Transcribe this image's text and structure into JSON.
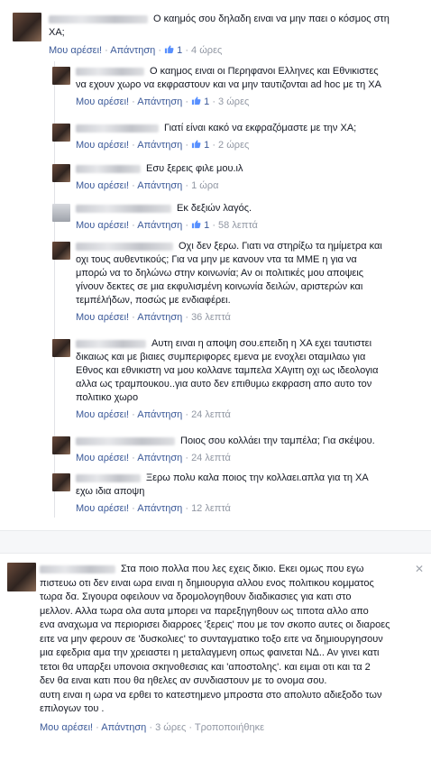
{
  "actions": {
    "like": "Μου αρέσει!",
    "reply": "Απάντηση",
    "dot": "·",
    "edited": "Τροποποιήθηκε"
  },
  "icons": {
    "like": "thumbs-up-icon",
    "close": "close-icon"
  },
  "colors": {
    "link": "#3b5998",
    "meta": "#9197a3",
    "text": "#141823"
  },
  "top_comment": {
    "text1": "Ο καημός σου δηλαδη ειναι να μην παει ο κόσμος στη",
    "text2": "ΧΑ;",
    "likes": "1",
    "time": "4 ώρες"
  },
  "replies": [
    {
      "lines": [
        "Ο καημος ειναι οι Περηφανοι Ελληνες και Εθνικιστες",
        "να εχουν χωρο να εκφραστουν και να μην ταυτιζονται ad hoc με τη ΧΑ"
      ],
      "likes": "1",
      "time": "3 ώρες"
    },
    {
      "lines": [
        "Γιατί είναι κακό να εκφραζόμαστε με την ΧΑ;"
      ],
      "likes": "1",
      "time": "2 ώρες"
    },
    {
      "lines": [
        "Εσυ ξερεις φιλε μου.ιλ"
      ],
      "likes": "",
      "time": "1 ώρα"
    },
    {
      "lines": [
        "Εκ δεξιών λαγός."
      ],
      "likes": "1",
      "time": "58 λεπτά"
    },
    {
      "lines": [
        "Οχι δεν ξερω. Γιατι να στηρίξω τα ημίμετρα και",
        "οχι τους αυθεντικούς; Για να μην με κανουν ντα τα ΜΜΕ η για να",
        "μπορώ να το δηλώνω στην κοινωνία; Αν οι πολιτικές μου αποψεις",
        "γίνουν δεκτες σε μια εκφυλισμένη κοινωνία δειλών, αριστερών και",
        "τεμπέλήδων, ποσώς με ενδιαφέρει."
      ],
      "likes": "",
      "time": "36 λεπτά"
    },
    {
      "lines": [
        "Αυτη ειναι η αποψη σου.επειδη η ΧΑ εχει ταυτιστει",
        "δικαιως και με βιαιες συμπεριφορες εμενα με ενοχλει οταμιλαω για",
        "Εθνος και εθνικιστη να μου κολλανε ταμπελα ΧΑγιτη οχι ως ιδεολογια",
        "αλλα ως τραμπουκου..για αυτο δεν επιθυμω εκφραση απο αυτο τον",
        "πολιτικο χωρο"
      ],
      "likes": "",
      "time": "24 λεπτά"
    },
    {
      "lines": [
        "Ποιος σου κολλάει την ταμπέλα; Για σκέψου."
      ],
      "likes": "",
      "time": "24 λεπτά"
    },
    {
      "lines": [
        "Ξερω πολυ καλα ποιος την κολλαει.απλα για τη ΧΑ",
        "εχω ιδια αποψη"
      ],
      "likes": "",
      "time": "12 λεπτά"
    }
  ],
  "second_comment": {
    "lines": [
      "Στα ποιο πολλα που λες εχεις δικιο. Εκει ομως που εγω",
      "πιστευω οτι δεν ειναι ωρα ειναι η δημιουργια αλλου ενος πολιτικου κομματος",
      "τωρα δα. Σιγουρα οφειλουν να δρομολογηθουν διαδικασιες για κατι στο",
      "μελλον. Αλλα τωρα ολα αυτα μπορει να παρεξηγηθουν ως τιποτα αλλο απο",
      "ενα αναχωμα να περιορισει διαρροες 'ξερεις' που με τον σκοπο αυτες οι διαροες",
      "ειτε να μην φερουν σε 'δυσκολιες' το συνταγματικο τοξο ειτε να δημιουργησουν",
      "μια εφεδρια αμα την χρειαστει η μεταλαγμενη οπως φαινεται ΝΔ.. Αν γινει κατι",
      "τετοι θα υπαρξει υπονοια σκηνοθεσιας και 'αποστολης'. και ειμαι οτι και τα 2",
      "δεν θα ειναι κατι που θα ηθελες αν συνδιαστουν με το ονομα σου.",
      "αυτη ειναι η ωρα να ερθει το κατεστημενο μπροστα στο απολυτο αδιεξοδο των",
      "επιλογων του ."
    ],
    "time": "3 ώρες"
  }
}
